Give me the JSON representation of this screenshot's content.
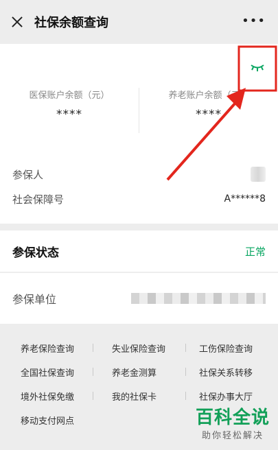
{
  "header": {
    "title": "社保余额查询",
    "more_label": "•••"
  },
  "balance": {
    "medical_label": "医保账户余额（元）",
    "medical_value": "****",
    "pension_label": "养老账户余额（元）",
    "pension_value": "****"
  },
  "info": {
    "insured_label": "参保人",
    "ssn_label": "社会保障号",
    "ssn_value": "A******8"
  },
  "status": {
    "label": "参保状态",
    "value": "正常"
  },
  "unit": {
    "label": "参保单位"
  },
  "links": [
    [
      "养老保险查询",
      "失业保险查询",
      "工伤保险查询"
    ],
    [
      "全国社保查询",
      "养老金测算",
      "社保关系转移"
    ],
    [
      "境外社保免缴",
      "我的社保卡",
      "社保办事大厅"
    ],
    [
      "移动支付网点"
    ]
  ],
  "watermark": {
    "title": "百科全说",
    "subtitle": "助你轻松解决"
  },
  "colors": {
    "accent_green": "#07a560",
    "highlight_red": "#e3261d"
  }
}
